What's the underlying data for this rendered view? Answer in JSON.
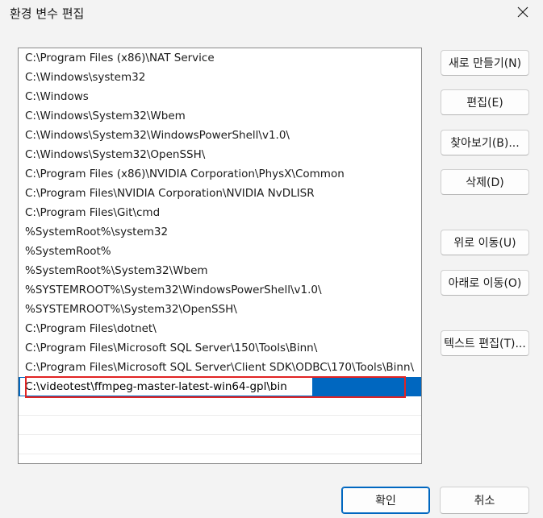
{
  "window": {
    "title": "환경 변수 편집",
    "close_icon": "close-icon"
  },
  "paths": [
    "C:\\Program Files (x86)\\NAT Service",
    "C:\\Windows\\system32",
    "C:\\Windows",
    "C:\\Windows\\System32\\Wbem",
    "C:\\Windows\\System32\\WindowsPowerShell\\v1.0\\",
    "C:\\Windows\\System32\\OpenSSH\\",
    "C:\\Program Files (x86)\\NVIDIA Corporation\\PhysX\\Common",
    "C:\\Program Files\\NVIDIA Corporation\\NVIDIA NvDLISR",
    "C:\\Program Files\\Git\\cmd",
    "%SystemRoot%\\system32",
    "%SystemRoot%",
    "%SystemRoot%\\System32\\Wbem",
    "%SYSTEMROOT%\\System32\\WindowsPowerShell\\v1.0\\",
    "%SYSTEMROOT%\\System32\\OpenSSH\\",
    "C:\\Program Files\\dotnet\\",
    "C:\\Program Files\\Microsoft SQL Server\\150\\Tools\\Binn\\",
    "C:\\Program Files\\Microsoft SQL Server\\Client SDK\\ODBC\\170\\Tools\\Binn\\"
  ],
  "editing_value": "C:\\videotest\\ffmpeg-master-latest-win64-gpl\\bin",
  "buttons": {
    "new": "새로 만들기(N)",
    "edit": "편집(E)",
    "browse": "찾아보기(B)...",
    "delete": "삭제(D)",
    "move_up": "위로 이동(U)",
    "move_down": "아래로 이동(O)",
    "edit_text": "텍스트 편집(T)...",
    "ok": "확인",
    "cancel": "취소"
  },
  "colors": {
    "selection": "#0067c0",
    "highlight": "#e02424",
    "background": "#f3f3f3"
  }
}
